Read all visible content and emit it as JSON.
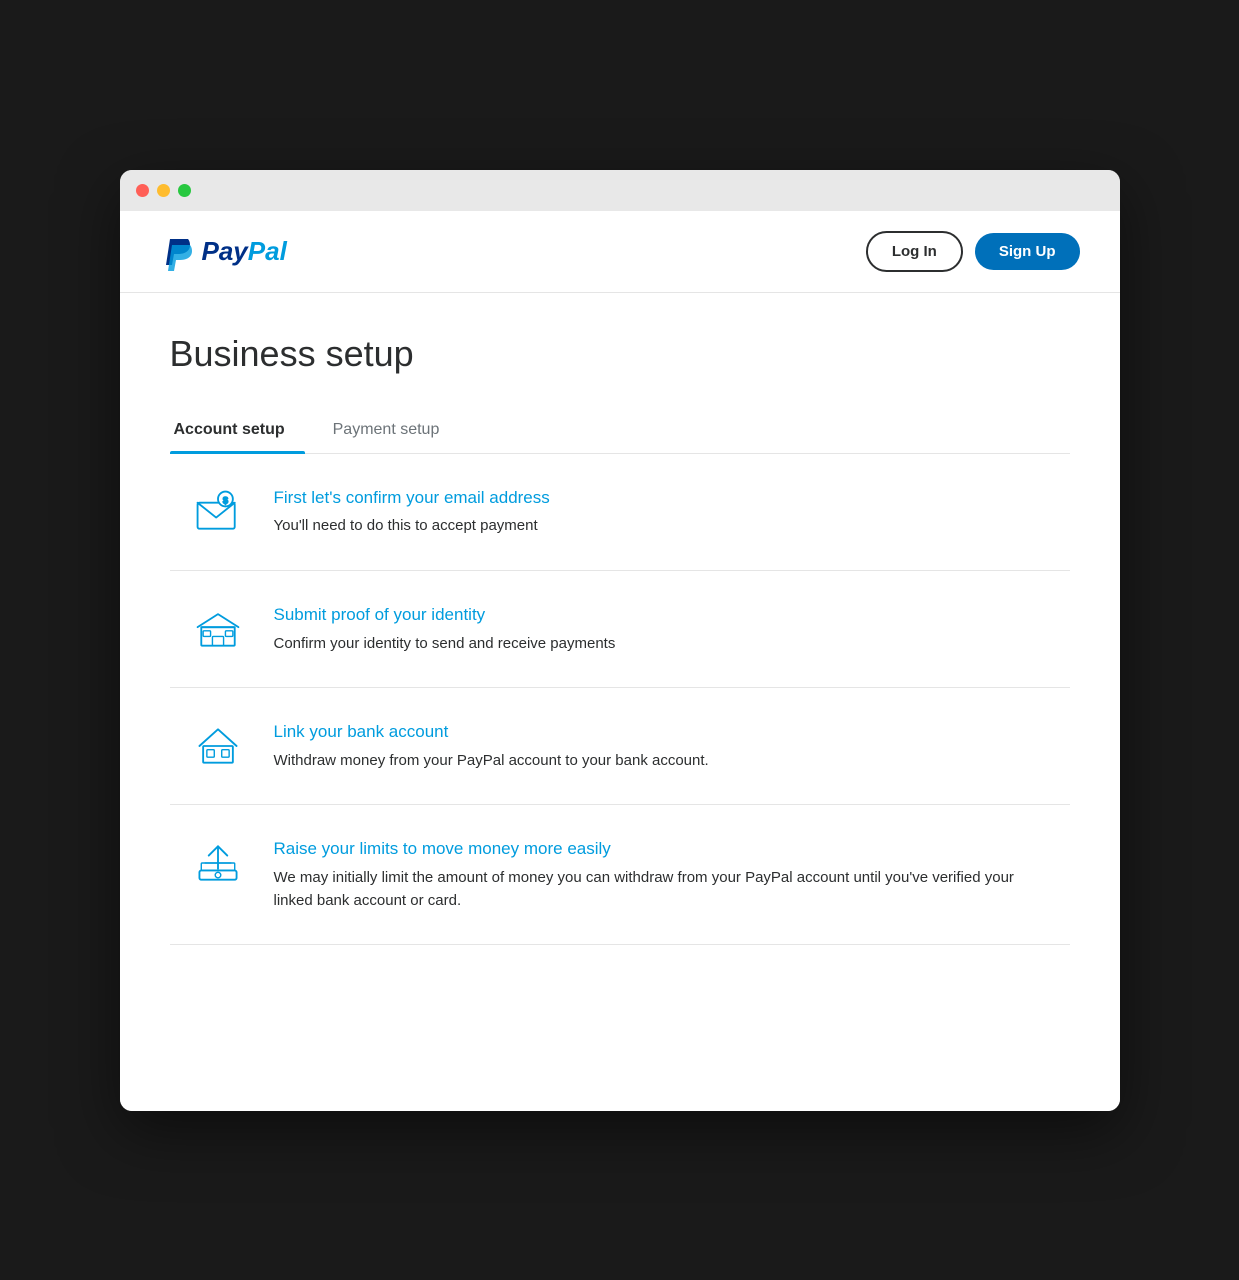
{
  "browser": {
    "traffic_lights": [
      "red",
      "yellow",
      "green"
    ]
  },
  "header": {
    "logo_text_pay": "Pay",
    "logo_text_pal": "Pal",
    "logo_p": "P",
    "login_label": "Log In",
    "signup_label": "Sign Up"
  },
  "page": {
    "title": "Business setup"
  },
  "tabs": [
    {
      "id": "account-setup",
      "label": "Account setup",
      "active": true
    },
    {
      "id": "payment-setup",
      "label": "Payment setup",
      "active": false
    }
  ],
  "setup_items": [
    {
      "id": "confirm-email",
      "title": "First let's confirm your email address",
      "description": "You'll need to do this to accept payment",
      "icon": "email"
    },
    {
      "id": "submit-identity",
      "title": "Submit proof of your identity",
      "description": "Confirm your identity to send and receive payments",
      "icon": "store"
    },
    {
      "id": "link-bank",
      "title": "Link your bank account",
      "description": "Withdraw money from your PayPal account to your bank account.",
      "icon": "bank"
    },
    {
      "id": "raise-limits",
      "title": "Raise your limits to move money more easily",
      "description": "We may initially limit the amount of money you can withdraw from your PayPal account until you've verified your linked bank account or card.",
      "icon": "upload"
    }
  ]
}
